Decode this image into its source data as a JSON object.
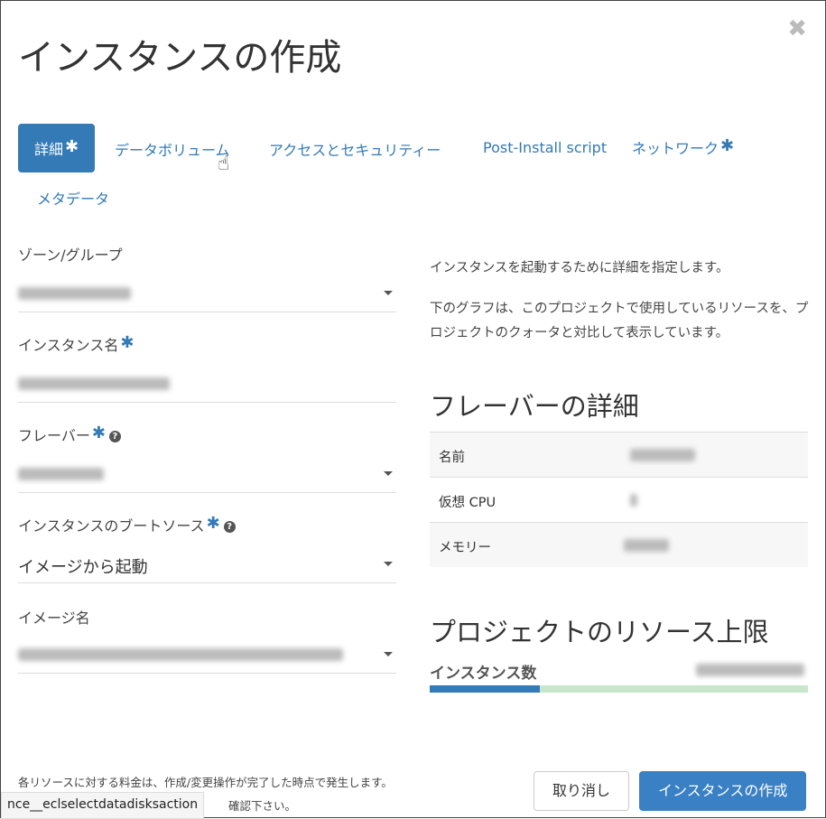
{
  "dialog": {
    "title": "インスタンスの作成",
    "close_icon": "close-icon"
  },
  "tabs": [
    {
      "label": "詳細",
      "required": "✱",
      "active": true
    },
    {
      "label": "データボリューム"
    },
    {
      "label": "アクセスとセキュリティー"
    },
    {
      "label": "Post-Install script"
    },
    {
      "label": "ネットワーク",
      "required": "✱"
    },
    {
      "label": "メタデータ"
    }
  ],
  "form": {
    "zone_label": "ゾーン/グループ",
    "instance_name_label": "インスタンス名",
    "flavor_label": "フレーバー",
    "boot_source_label": "インスタンスのブートソース",
    "boot_source_value": "イメージから起動",
    "image_name_label": "イメージ名",
    "required": "✱",
    "help": "?"
  },
  "info": {
    "p1": "インスタンスを起動するために詳細を指定します。",
    "p2": "下のグラフは、このプロジェクトで使用しているリソースを、プロジェクトのクォータと対比して表示しています。",
    "flavor_heading": "フレーバーの詳細",
    "flavor_rows": [
      {
        "key": "名前"
      },
      {
        "key": "仮想 CPU"
      },
      {
        "key": "メモリー"
      }
    ],
    "limits_heading": "プロジェクトのリソース上限",
    "instances_label": "インスタンス数",
    "instances_usage_percent": 29,
    "bar_colors": {
      "used": "#337ab7",
      "remaining": "#c8e6c9"
    }
  },
  "footer": {
    "note1": "各リソースに対する料金は、作成/変更操作が完了した時点で発生します。",
    "note2": "確認下さい。",
    "cancel": "取り消し",
    "create": "インスタンスの作成",
    "status_url": "nce__eclselectdatadisksaction"
  }
}
